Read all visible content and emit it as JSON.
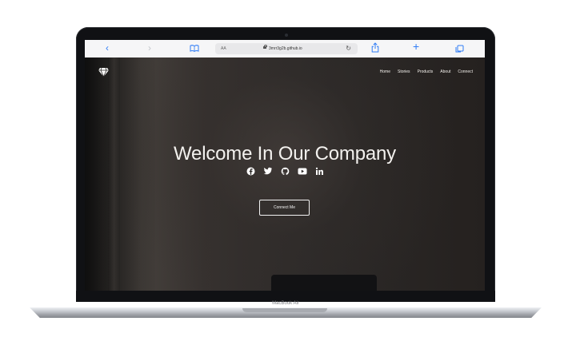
{
  "browser": {
    "reader_label": "AA",
    "url": "3mrr3g2b.github.io",
    "icons": {
      "back": "chevron-left-icon",
      "forward": "chevron-right-icon",
      "bookmarks": "book-icon",
      "lock": "lock-icon",
      "reload": "reload-icon",
      "share": "share-icon",
      "new_tab": "plus-icon",
      "tabs": "tabs-icon"
    }
  },
  "site": {
    "logo": "diamond-logo-icon",
    "nav": [
      {
        "label": "Home"
      },
      {
        "label": "Stories"
      },
      {
        "label": "Products"
      },
      {
        "label": "About"
      },
      {
        "label": "Connect"
      }
    ],
    "hero": {
      "title": "Welcome In Our Company",
      "button_label": "Connect Me",
      "social_icons": [
        "facebook-icon",
        "twitter-icon",
        "github-icon",
        "youtube-icon",
        "linkedin-icon"
      ]
    }
  },
  "device": {
    "model_label": "MacBook Air"
  },
  "colors": {
    "safari_blue": "#2f7cf6",
    "page_background": "#2a2725",
    "text": "#f3f1ee",
    "laptop_bezel": "#101114",
    "laptop_silver": "#c8cbd1"
  }
}
